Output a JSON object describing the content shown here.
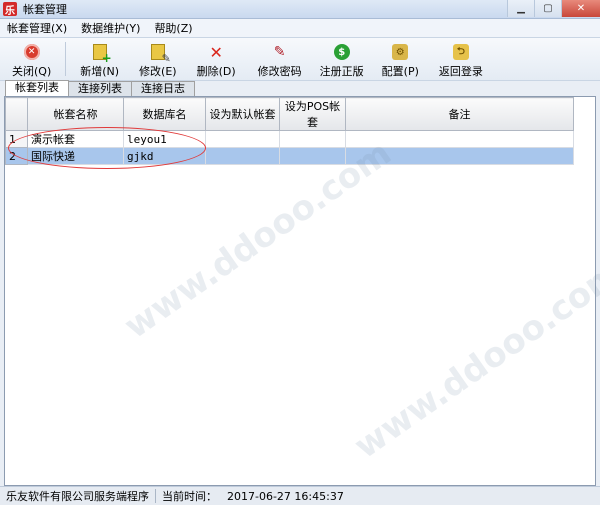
{
  "window": {
    "title": "帐套管理",
    "app_icon_glyph": "乐"
  },
  "menu": [
    "帐套管理(X)",
    "数据维护(Y)",
    "帮助(Z)"
  ],
  "toolbar": {
    "close": "关闭(Q)",
    "add": "新增(N)",
    "edit": "修改(E)",
    "delete": "删除(D)",
    "change_password": "修改密码",
    "register": "注册正版",
    "config": "配置(P)",
    "back_login": "返回登录"
  },
  "tabs": [
    "帐套列表",
    "连接列表",
    "连接日志"
  ],
  "table": {
    "columns": [
      "帐套名称",
      "数据库名",
      "设为默认帐套",
      "设为POS帐套",
      "备注"
    ],
    "rows": [
      {
        "num": "1",
        "name": "演示帐套",
        "db": "leyou1",
        "default": "",
        "pos": "",
        "note": ""
      },
      {
        "num": "2",
        "name": "国际快递",
        "db": "gjkd",
        "default": "",
        "pos": "",
        "note": ""
      }
    ]
  },
  "status": {
    "company": "乐友软件有限公司服务端程序",
    "time_label": "当前时间：",
    "time_value": "2017-06-27 16:45:37"
  },
  "colors": {
    "accent_red": "#d83b2d",
    "selection": "#a8c6ec"
  }
}
